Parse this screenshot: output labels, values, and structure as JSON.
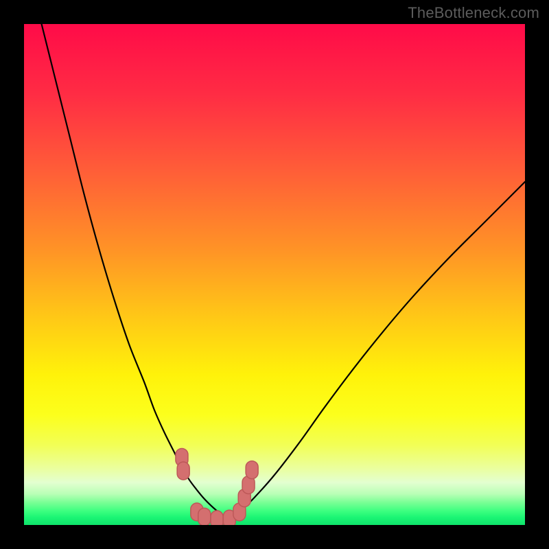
{
  "watermark": "TheBottleneck.com",
  "colors": {
    "frame": "#000000",
    "curve": "#000000",
    "marker_fill": "#d46f6f",
    "marker_stroke": "#bd5858"
  },
  "chart_data": {
    "type": "line",
    "title": "",
    "xlabel": "",
    "ylabel": "",
    "xlim": [
      0,
      100
    ],
    "ylim": [
      0,
      100
    ],
    "gradient_stops": [
      {
        "pos": 0.0,
        "color": "#ff0b48"
      },
      {
        "pos": 0.14,
        "color": "#ff2c44"
      },
      {
        "pos": 0.3,
        "color": "#ff6037"
      },
      {
        "pos": 0.45,
        "color": "#ff9326"
      },
      {
        "pos": 0.58,
        "color": "#ffc617"
      },
      {
        "pos": 0.7,
        "color": "#fff20a"
      },
      {
        "pos": 0.78,
        "color": "#fcff1c"
      },
      {
        "pos": 0.84,
        "color": "#f2ff55"
      },
      {
        "pos": 0.885,
        "color": "#ebff9b"
      },
      {
        "pos": 0.915,
        "color": "#e3ffd0"
      },
      {
        "pos": 0.938,
        "color": "#b9ffb6"
      },
      {
        "pos": 0.955,
        "color": "#7aff95"
      },
      {
        "pos": 0.972,
        "color": "#3dff80"
      },
      {
        "pos": 0.985,
        "color": "#1bf574"
      },
      {
        "pos": 1.0,
        "color": "#0fe36b"
      }
    ],
    "series": [
      {
        "name": "left-curve",
        "x": [
          3.5,
          6,
          9,
          12,
          15,
          18,
          21,
          24,
          26,
          28,
          30,
          31.5,
          33,
          34.5,
          36,
          37.5,
          39,
          40.5
        ],
        "values": [
          100,
          90,
          78,
          66,
          55,
          45,
          36,
          28.5,
          23,
          18.5,
          14.5,
          11.5,
          9,
          7,
          5.2,
          3.7,
          2.4,
          1.2
        ]
      },
      {
        "name": "right-curve",
        "x": [
          40.5,
          43,
          46,
          50,
          55,
          60,
          66,
          72,
          78,
          85,
          92,
          100
        ],
        "values": [
          1.2,
          2.6,
          5.5,
          10,
          16.5,
          23.5,
          31.5,
          39,
          46,
          53.5,
          60.5,
          68.5
        ]
      },
      {
        "name": "markers",
        "x": [
          31.5,
          31.8,
          34.5,
          36,
          38.5,
          41.0,
          43.0,
          44.0,
          44.8,
          45.5
        ],
        "values": [
          13.5,
          10.8,
          2.6,
          1.6,
          1.1,
          1.2,
          2.6,
          5.4,
          8.0,
          11.0
        ]
      }
    ]
  }
}
